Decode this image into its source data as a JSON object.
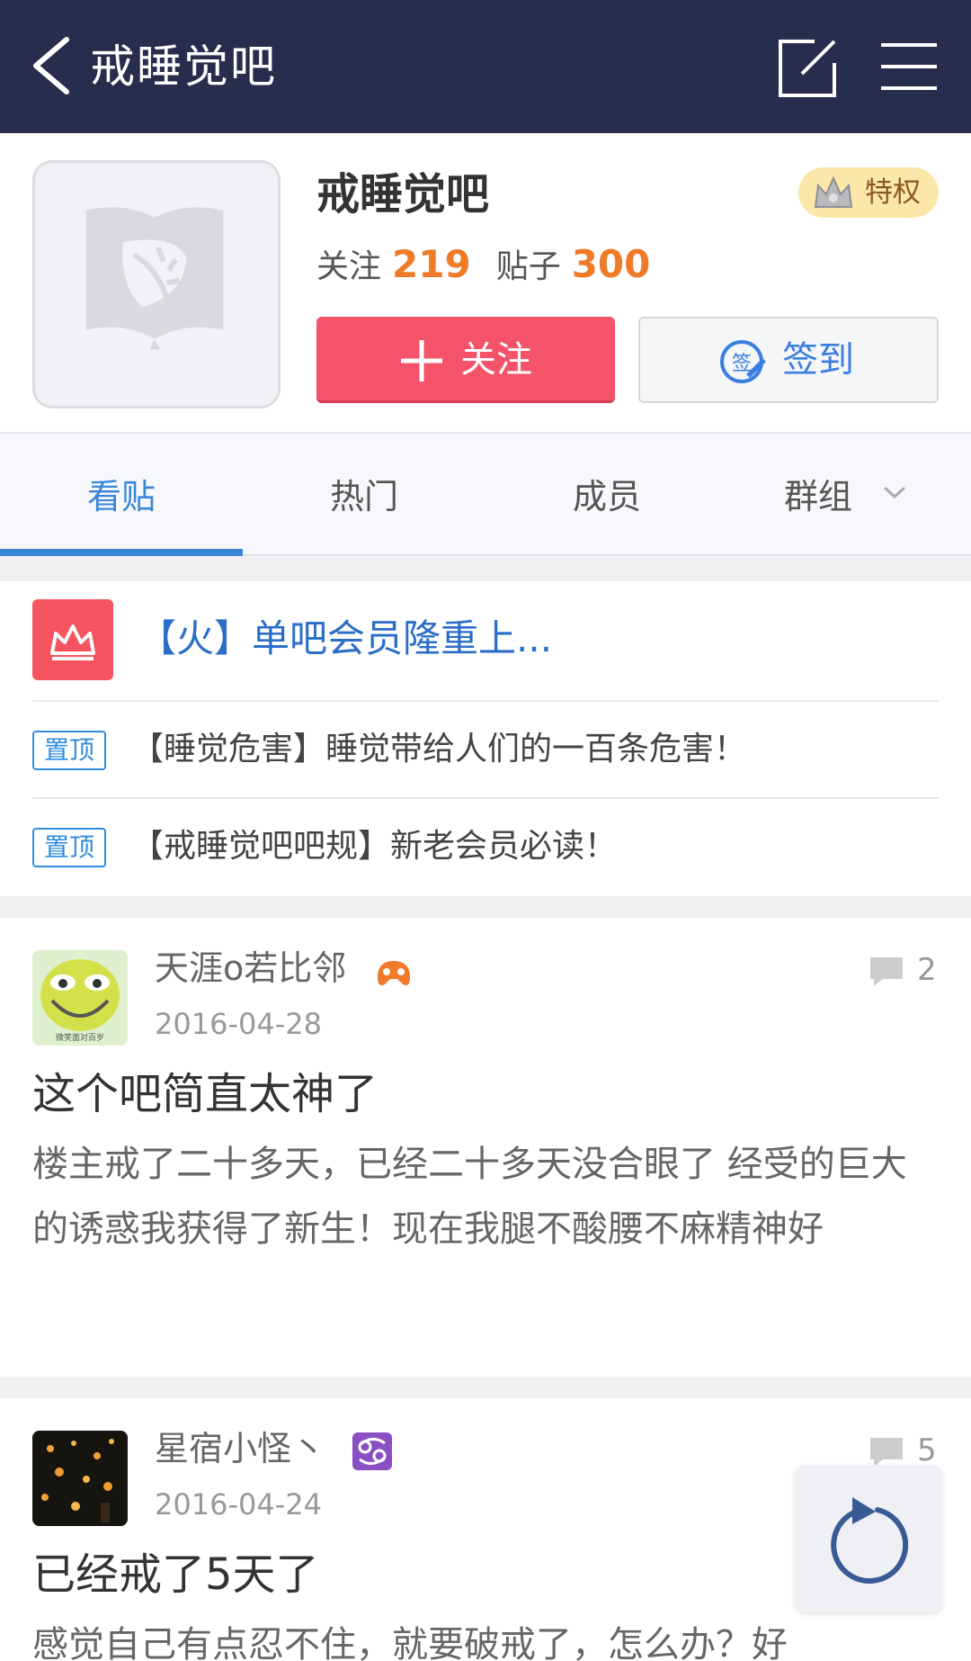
{
  "topbar": {
    "title": "戒睡觉吧",
    "icons": [
      "back-icon",
      "compose-icon",
      "menu-icon"
    ]
  },
  "forum": {
    "name": "戒睡觉吧",
    "vip_label": "特权",
    "follow_label": "关注",
    "follow_count": "219",
    "posts_label": "贴子",
    "posts_count": "300",
    "follow_button": "关注",
    "sign_button": "签到",
    "sign_icon_text": "签"
  },
  "tabs": [
    {
      "label": "看贴",
      "active": true
    },
    {
      "label": "热门",
      "active": false
    },
    {
      "label": "成员",
      "active": false
    },
    {
      "label": "群组",
      "active": false
    }
  ],
  "notice": {
    "vip_link": "【火】单吧会员隆重上...",
    "pinned": [
      {
        "tag": "置顶",
        "text": "【睡觉危害】睡觉带给人们的一百条危害！"
      },
      {
        "tag": "置顶",
        "text": "【戒睡觉吧吧规】新老会员必读！"
      }
    ]
  },
  "posts": [
    {
      "author": "天涯o若比邻",
      "date": "2016-04-28",
      "replies": "2",
      "title": "这个吧简直太神了",
      "body": "楼主戒了二十多天，已经二十多天没合眼了 经受的巨大的诱惑我获得了新生！现在我腿不酸腰不麻精神好",
      "avatar_caption": "微笑面对百岁"
    },
    {
      "author": "星宿小怪丶",
      "date": "2016-04-24",
      "replies": "5",
      "title": "已经戒了5天了",
      "body": "感觉自己有点忍不住，就要破戒了，怎么办？好"
    }
  ],
  "colors": {
    "topbar": "#282c4d",
    "accent_blue": "#3a86d8",
    "follow_red": "#f4536a",
    "count_orange": "#ef7a27"
  }
}
